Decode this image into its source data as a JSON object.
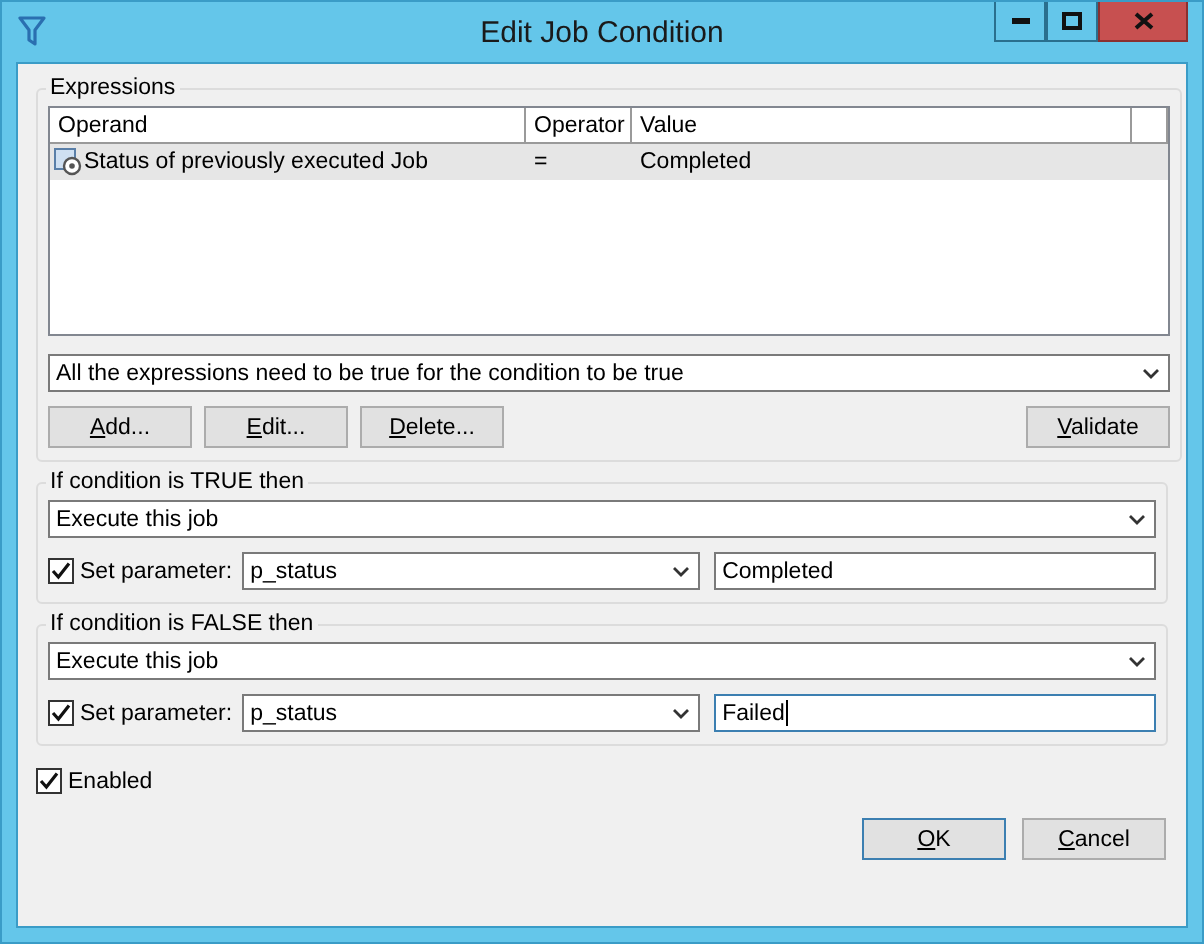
{
  "window": {
    "title": "Edit Job Condition"
  },
  "expressions": {
    "title": "Expressions",
    "columns": [
      "Operand",
      "Operator",
      "Value"
    ],
    "rows": [
      {
        "operand": "Status of previously executed Job",
        "operator": "=",
        "value": "Completed",
        "selected": true
      }
    ],
    "mode": "All the expressions need to be true for the condition to be true",
    "buttons": [
      "Add...",
      "Edit...",
      "Delete..."
    ],
    "validate_button": "Validate"
  },
  "branches": [
    {
      "title": "If condition is TRUE then",
      "action": "Execute this job",
      "set_parameter": {
        "label": "Set parameter:",
        "checked": true,
        "parameter": "p_status",
        "value": "Completed",
        "focused": false
      }
    },
    {
      "title": "If condition is FALSE then",
      "action": "Execute this job",
      "set_parameter": {
        "label": "Set parameter:",
        "checked": true,
        "parameter": "p_status",
        "value": "Failed",
        "focused": true
      }
    }
  ],
  "enabled": {
    "label": "Enabled",
    "checked": true
  },
  "buttons": [
    "OK",
    "Cancel"
  ]
}
